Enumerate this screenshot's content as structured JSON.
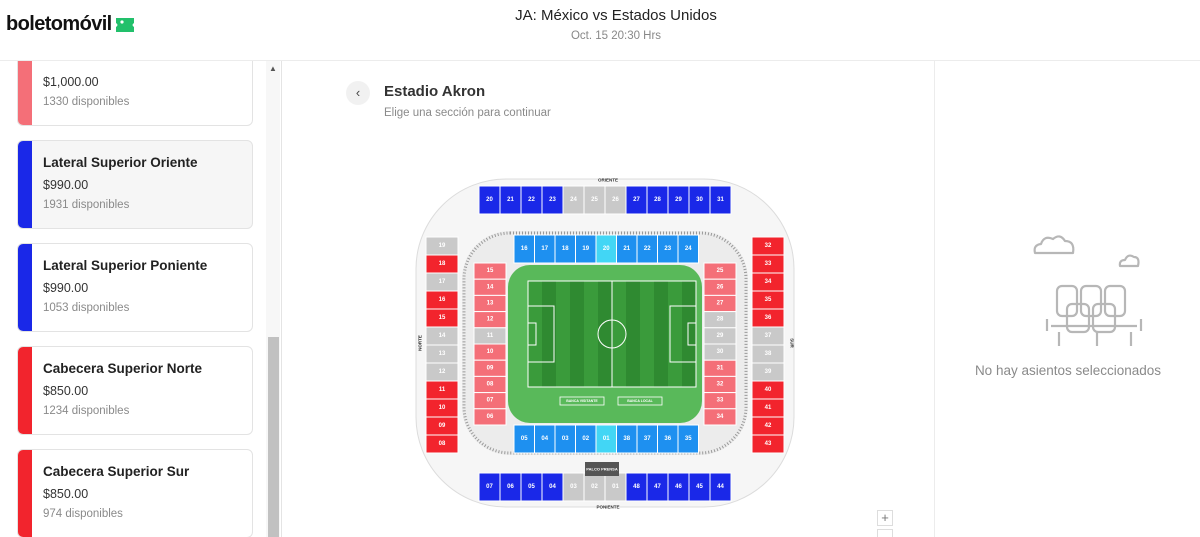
{
  "header": {
    "brand": "boletomóvil",
    "event_title": "JA: México vs Estados Unidos",
    "event_date": "Oct. 15 20:30 Hrs"
  },
  "sidebar": {
    "sections": [
      {
        "name": "",
        "price": "$1,000.00",
        "available": "1330 disponibles",
        "color": "#f46f78",
        "selected": false
      },
      {
        "name": "Lateral Superior Oriente",
        "price": "$990.00",
        "available": "1931 disponibles",
        "color": "#1a28e8",
        "selected": true
      },
      {
        "name": "Lateral Superior Poniente",
        "price": "$990.00",
        "available": "1053 disponibles",
        "color": "#1a28e8",
        "selected": false
      },
      {
        "name": "Cabecera Superior Norte",
        "price": "$850.00",
        "available": "1234 disponibles",
        "color": "#f2242d",
        "selected": false
      },
      {
        "name": "Cabecera Superior Sur",
        "price": "$850.00",
        "available": "974 disponibles",
        "color": "#f2242d",
        "selected": false
      }
    ]
  },
  "main": {
    "back_icon": "chevron-left-icon",
    "venue": "Estadio Akron",
    "hint": "Elige una sección para continuar",
    "zoom_in_label": "+",
    "map": {
      "directions": {
        "north": "NORTE",
        "south": "SUR",
        "east": "ORIENTE",
        "west": "PONIENTE"
      },
      "press_box": "PALCO PRENSA",
      "field_labels": [
        "BANCA VISITANTE",
        "BANCA LOCAL"
      ],
      "colors": {
        "upper_lateral": "#1a28e8",
        "upper_end": "#f2242d",
        "lower_lateral": "#1e90f0",
        "lower_end": "#f46f78",
        "unavailable": "#c9c9c9",
        "premium": "#42d6f5",
        "pitch": "#2e8b2e"
      },
      "upper_top": [
        [
          "20",
          "blue"
        ],
        [
          "21",
          "blue"
        ],
        [
          "22",
          "blue"
        ],
        [
          "23",
          "blue"
        ],
        [
          "24",
          "gray"
        ],
        [
          "25",
          "gray"
        ],
        [
          "26",
          "gray"
        ],
        [
          "27",
          "blue"
        ],
        [
          "28",
          "blue"
        ],
        [
          "29",
          "blue"
        ],
        [
          "30",
          "blue"
        ],
        [
          "31",
          "blue"
        ]
      ],
      "upper_bottom": [
        [
          "07",
          "blue"
        ],
        [
          "06",
          "blue"
        ],
        [
          "05",
          "blue"
        ],
        [
          "04",
          "blue"
        ],
        [
          "03",
          "gray"
        ],
        [
          "02",
          "gray"
        ],
        [
          "01",
          "gray"
        ],
        [
          "48",
          "blue"
        ],
        [
          "47",
          "blue"
        ],
        [
          "46",
          "blue"
        ],
        [
          "45",
          "blue"
        ],
        [
          "44",
          "blue"
        ]
      ],
      "upper_left": [
        [
          "19",
          "gray"
        ],
        [
          "18",
          "red"
        ],
        [
          "17",
          "gray"
        ],
        [
          "16",
          "red"
        ],
        [
          "15",
          "red"
        ],
        [
          "14",
          "gray"
        ],
        [
          "13",
          "gray"
        ],
        [
          "12",
          "gray"
        ],
        [
          "11",
          "red"
        ],
        [
          "10",
          "red"
        ],
        [
          "09",
          "red"
        ],
        [
          "08",
          "red"
        ]
      ],
      "upper_right": [
        [
          "32",
          "red"
        ],
        [
          "33",
          "red"
        ],
        [
          "34",
          "red"
        ],
        [
          "35",
          "red"
        ],
        [
          "36",
          "red"
        ],
        [
          "37",
          "gray"
        ],
        [
          "38",
          "gray"
        ],
        [
          "39",
          "gray"
        ],
        [
          "40",
          "red"
        ],
        [
          "41",
          "red"
        ],
        [
          "42",
          "red"
        ],
        [
          "43",
          "red"
        ]
      ],
      "lower_top": [
        [
          "16",
          "light"
        ],
        [
          "17",
          "light"
        ],
        [
          "18",
          "light"
        ],
        [
          "19",
          "light"
        ],
        [
          "20",
          "cyan"
        ],
        [
          "21",
          "light"
        ],
        [
          "22",
          "light"
        ],
        [
          "23",
          "light"
        ],
        [
          "24",
          "light"
        ]
      ],
      "lower_bottom": [
        [
          "05",
          "light"
        ],
        [
          "04",
          "light"
        ],
        [
          "03",
          "light"
        ],
        [
          "02",
          "light"
        ],
        [
          "01",
          "cyan"
        ],
        [
          "38",
          "light"
        ],
        [
          "37",
          "light"
        ],
        [
          "36",
          "light"
        ],
        [
          "35",
          "light"
        ]
      ],
      "lower_left": [
        [
          "15",
          "pink"
        ],
        [
          "14",
          "pink"
        ],
        [
          "13",
          "pink"
        ],
        [
          "12",
          "pink"
        ],
        [
          "11",
          "gray"
        ],
        [
          "10",
          "pink"
        ],
        [
          "09",
          "pink"
        ],
        [
          "08",
          "pink"
        ],
        [
          "07",
          "pink"
        ],
        [
          "06",
          "pink"
        ]
      ],
      "lower_right": [
        [
          "25",
          "pink"
        ],
        [
          "26",
          "pink"
        ],
        [
          "27",
          "pink"
        ],
        [
          "28",
          "gray"
        ],
        [
          "29",
          "gray"
        ],
        [
          "30",
          "gray"
        ],
        [
          "31",
          "pink"
        ],
        [
          "32",
          "pink"
        ],
        [
          "33",
          "pink"
        ],
        [
          "34",
          "pink"
        ]
      ]
    }
  },
  "cart": {
    "empty_text": "No hay asientos seleccionados",
    "illustration": "empty-seats-icon"
  }
}
